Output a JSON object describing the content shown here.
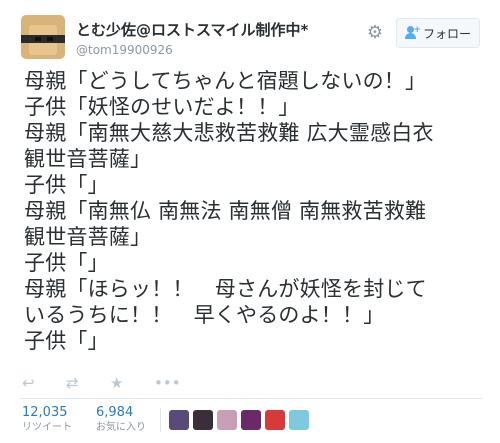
{
  "user": {
    "display_name": "とむ少佐@ロストスマイル制作中*",
    "handle": "@tom19900926"
  },
  "header": {
    "follow_label": "フォロー",
    "settings_icon": "gear-icon",
    "follow_icon": "add-person-icon"
  },
  "tweet": {
    "lines": [
      "母親「どうしてちゃんと宿題しないの！」",
      "子供「妖怪のせいだよ！！」",
      "母親「南無大慈大悲救苦救難 広大霊感白衣",
      "観世音菩薩」",
      "子供「」",
      "母親「南無仏 南無法 南無僧 南無救苦救難",
      "観世音菩薩」",
      "子供「」",
      "母親「ほらッ！！　母さんが妖怪を封じて",
      "いるうちに！！　早くやるのよ！！」",
      "子供「」"
    ]
  },
  "actions": {
    "reply_icon": "reply-icon",
    "retweet_icon": "retweet-icon",
    "favorite_icon": "star-icon",
    "more_icon": "more-icon"
  },
  "stats": {
    "retweets_count": "12,035",
    "retweets_label": "リツイート",
    "favorites_count": "6,984",
    "favorites_label": "お気に入り"
  },
  "favoriters": {
    "colors": [
      "#5a4a7a",
      "#3a2e3a",
      "#c7a0b8",
      "#6a2a6a",
      "#d83a3a",
      "#7fc8e0"
    ]
  },
  "colors": {
    "link": "#2b7bb9",
    "muted": "#8899a6",
    "text": "#292f33"
  }
}
